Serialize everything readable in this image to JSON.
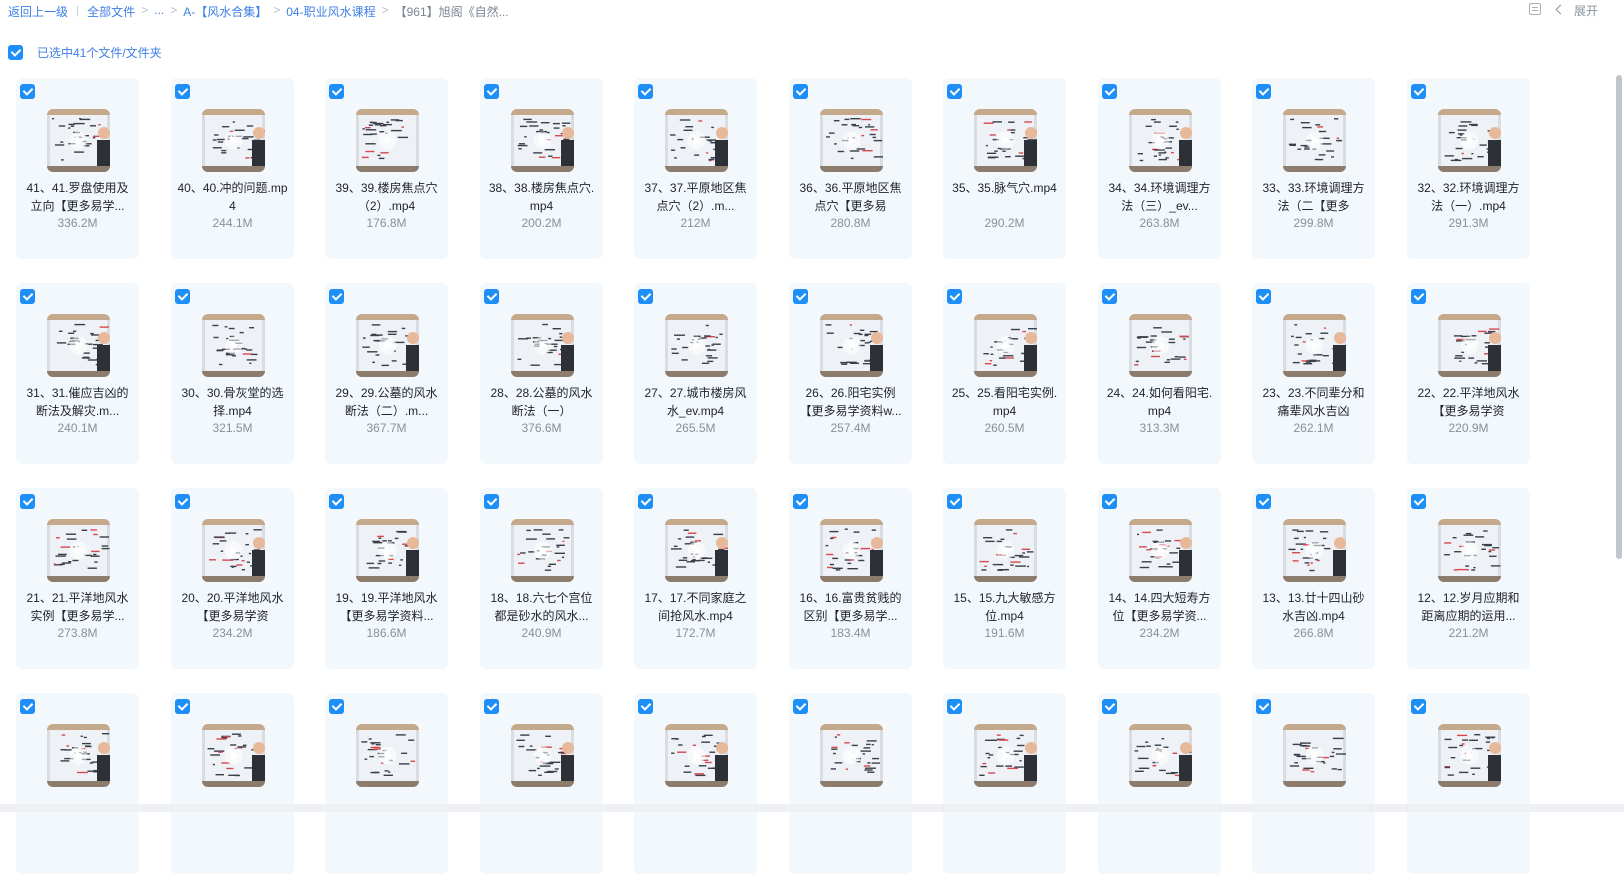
{
  "breadcrumb": {
    "back": "返回上一级",
    "items": [
      "全部文件",
      "...",
      "A-【风水合集】",
      "04-职业风水课程"
    ],
    "current": "【961】旭阁《自然..."
  },
  "toolbar": {
    "expand_label": "展开"
  },
  "selection": {
    "text": "已选中41个文件/文件夹"
  },
  "files": [
    {
      "name": "41、41.罗盘使用及立向【更多易学...",
      "size": "336.2M"
    },
    {
      "name": "40、40.冲的问题.mp4",
      "size": "244.1M"
    },
    {
      "name": "39、39.楼房焦点穴（2）.mp4",
      "size": "176.8M"
    },
    {
      "name": "38、38.楼房焦点穴.mp4",
      "size": "200.2M"
    },
    {
      "name": "37、37.平原地区焦点穴（2）.m...",
      "size": "212M"
    },
    {
      "name": "36、36.平原地区焦点穴【更多易",
      "size": "280.8M"
    },
    {
      "name": "35、35.脉气穴.mp4",
      "size": "290.2M"
    },
    {
      "name": "34、34.环境调理方法（三）_ev...",
      "size": "263.8M"
    },
    {
      "name": "33、33.环境调理方法（二【更多",
      "size": "299.8M"
    },
    {
      "name": "32、32.环境调理方法（一）.mp4",
      "size": "291.3M"
    },
    {
      "name": "31、31.催应吉凶的断法及解灾.m...",
      "size": "240.1M"
    },
    {
      "name": "30、30.骨灰堂的选择.mp4",
      "size": "321.5M"
    },
    {
      "name": "29、29.公墓的风水断法（二）.m...",
      "size": "367.7M"
    },
    {
      "name": "28、28.公墓的风水断法（一）",
      "size": "376.6M"
    },
    {
      "name": "27、27.城市楼房风水_ev.mp4",
      "size": "265.5M"
    },
    {
      "name": "26、26.阳宅实例【更多易学资料w...",
      "size": "257.4M"
    },
    {
      "name": "25、25.看阳宅实例.mp4",
      "size": "260.5M"
    },
    {
      "name": "24、24.如何看阳宅.mp4",
      "size": "313.3M"
    },
    {
      "name": "23、23.不同辈分和痛辈风水吉凶",
      "size": "262.1M"
    },
    {
      "name": "22、22.平洋地风水【更多易学资",
      "size": "220.9M"
    },
    {
      "name": "21、21.平洋地风水实例【更多易学...",
      "size": "273.8M"
    },
    {
      "name": "20、20.平洋地风水【更多易学资",
      "size": "234.2M"
    },
    {
      "name": "19、19.平洋地风水【更多易学资料...",
      "size": "186.6M"
    },
    {
      "name": "18、18.六七个宫位都是砂水的风水...",
      "size": "240.9M"
    },
    {
      "name": "17、17.不同家庭之间抢风水.mp4",
      "size": "172.7M"
    },
    {
      "name": "16、16.富贵贫贱的区别【更多易学...",
      "size": "183.4M"
    },
    {
      "name": "15、15.九大敏感方位.mp4",
      "size": "191.6M"
    },
    {
      "name": "14、14.四大短寿方位【更多易学资...",
      "size": "234.2M"
    },
    {
      "name": "13、13.廿十四山砂水吉凶.mp4",
      "size": "266.8M"
    },
    {
      "name": "12、12.岁月应期和距离应期的运用...",
      "size": "221.2M"
    },
    {
      "name": "",
      "size": ""
    },
    {
      "name": "",
      "size": ""
    },
    {
      "name": "",
      "size": ""
    },
    {
      "name": "",
      "size": ""
    },
    {
      "name": "",
      "size": ""
    },
    {
      "name": "",
      "size": ""
    },
    {
      "name": "",
      "size": ""
    },
    {
      "name": "",
      "size": ""
    },
    {
      "name": "",
      "size": ""
    },
    {
      "name": "",
      "size": ""
    }
  ],
  "icons": {
    "check": "check-icon",
    "play": "play-icon",
    "list": "list-view-icon",
    "back": "chevron-left-icon"
  },
  "colors": {
    "accent": "#1e8ff7",
    "link": "#3e7fe6",
    "card": "#f3f8fd"
  }
}
